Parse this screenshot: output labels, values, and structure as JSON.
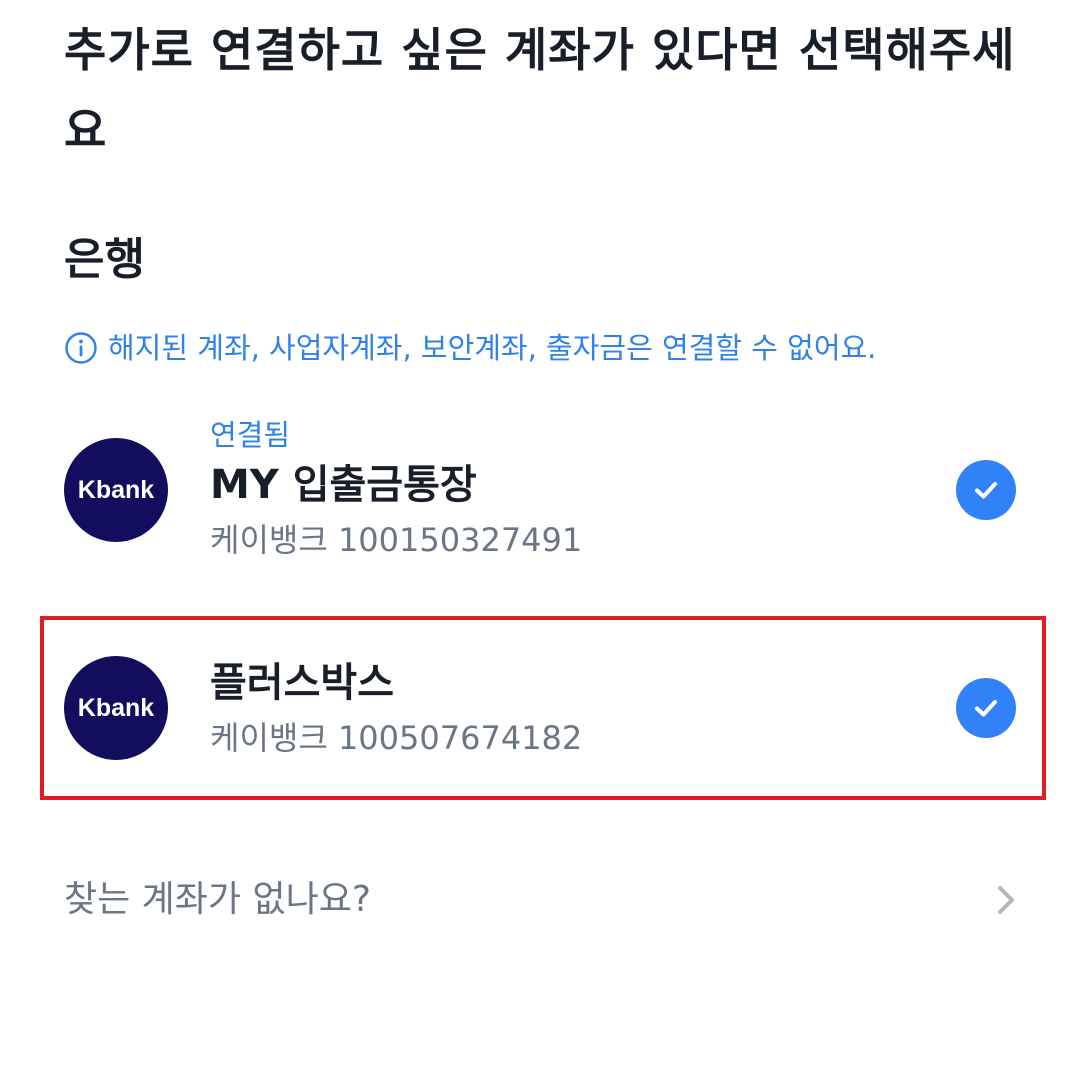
{
  "header": {
    "title": "추가로 연결하고 싶은 계좌가 있다면 선택해주세요"
  },
  "bank_section": {
    "title": "은행",
    "notice": "해지된 계좌, 사업자계좌, 보안계좌, 출자금은 연결할 수 없어요."
  },
  "accounts": [
    {
      "status": "연결됨",
      "name": "MY 입출금통장",
      "bank": "케이뱅크",
      "number": "100150327491",
      "logo_text": "Kbank",
      "checked": true
    },
    {
      "status": "",
      "name": "플러스박스",
      "bank": "케이뱅크",
      "number": "100507674182",
      "logo_text": "Kbank",
      "checked": true
    }
  ],
  "footer": {
    "find_label": "찾는 계좌가 없나요?"
  },
  "colors": {
    "accent": "#3182f6",
    "logo_bg": "#130d5e",
    "highlight_border": "#e31b23"
  }
}
